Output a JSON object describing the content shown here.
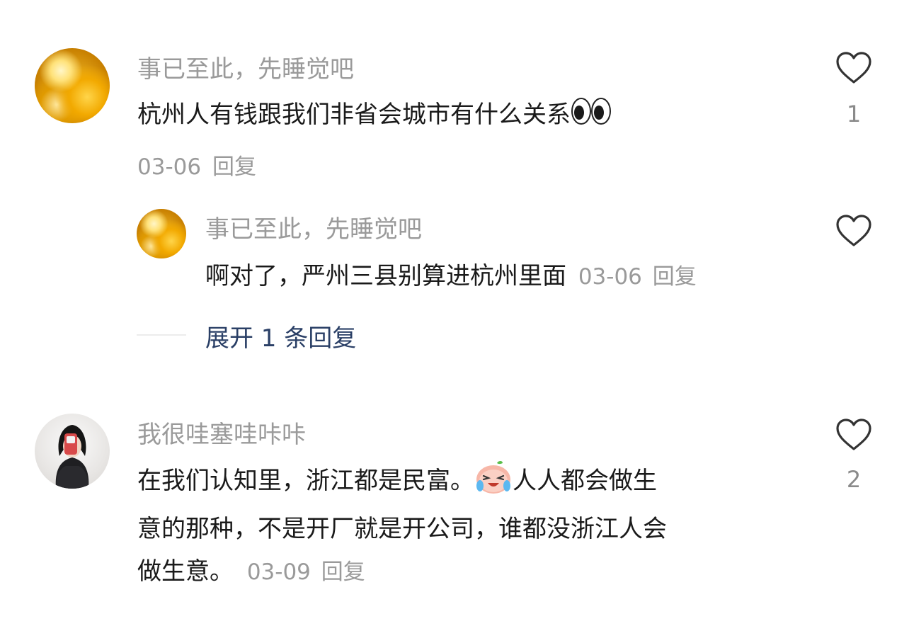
{
  "comments": [
    {
      "username": "事已至此，先睡觉吧",
      "text": "杭州人有钱跟我们非省会城市有什么关系",
      "emoji_icon": "eyes-emoji",
      "date": "03-06",
      "reply_label": "回复",
      "like_count": "1",
      "replies": [
        {
          "username": "事已至此，先睡觉吧",
          "text": "啊对了，严州三县别算进杭州里面",
          "date": "03-06",
          "reply_label": "回复"
        }
      ],
      "expand_label": "展开 1 条回复"
    },
    {
      "username": "我很哇塞哇咔咔",
      "text_part1": "在我们认知里，浙江都是民富。",
      "emoji_icon": "laughing-tears-emoji",
      "text_part2": "人人都会做生",
      "text_line2": "意的那种，不是开厂就是开公司，谁都没浙江人会",
      "text_line3": "做生意。",
      "date": "03-09",
      "reply_label": "回复",
      "like_count": "2"
    }
  ]
}
